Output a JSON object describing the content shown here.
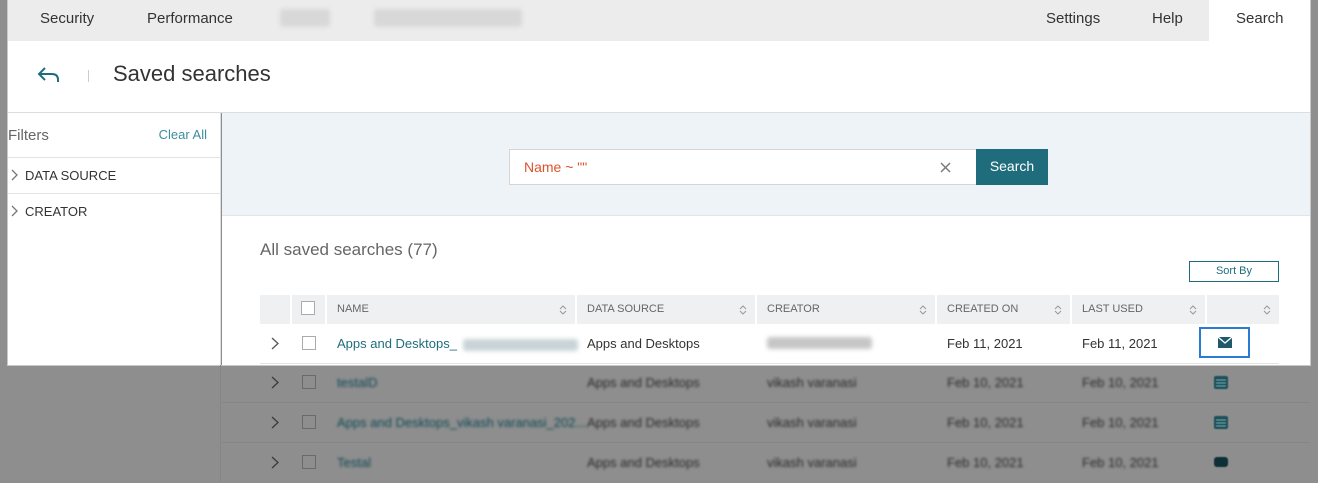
{
  "nav": {
    "tabs": [
      "Security",
      "Performance"
    ],
    "right_tabs": [
      "Settings",
      "Help"
    ],
    "active_tab": "Search"
  },
  "header": {
    "title": "Saved searches"
  },
  "filters": {
    "title": "Filters",
    "clear_all": "Clear All",
    "groups": [
      "DATA SOURCE",
      "CREATOR"
    ]
  },
  "search": {
    "value": "Name ~ \"\"",
    "button": "Search"
  },
  "list": {
    "title": "All saved searches (77)",
    "sort_label": "Sort By",
    "columns": [
      "NAME",
      "DATA SOURCE",
      "CREATOR",
      "CREATED ON",
      "LAST USED"
    ],
    "rows": [
      {
        "name": "Apps and Desktops_",
        "data_source": "Apps and Desktops",
        "creator": "",
        "created_on": "Feb 11, 2021",
        "last_used": "Feb 11, 2021",
        "action_icon": "email-icon"
      },
      {
        "name": "testalD",
        "data_source": "Apps and Desktops",
        "creator": "vikash varanasi",
        "created_on": "Feb 10, 2021",
        "last_used": "Feb 10, 2021",
        "action_icon": "report-icon"
      },
      {
        "name": "Apps and Desktops_vikash varanasi_202...",
        "data_source": "Apps and Desktops",
        "creator": "vikash varanasi",
        "created_on": "Feb 10, 2021",
        "last_used": "Feb 10, 2021",
        "action_icon": "report-icon"
      },
      {
        "name": "Testal",
        "data_source": "Apps and Desktops",
        "creator": "vikash varanasi",
        "created_on": "Feb 10, 2021",
        "last_used": "Feb 10, 2021",
        "action_icon": "monitor-icon"
      }
    ]
  },
  "colors": {
    "accent": "#1f6d7c",
    "search_value": "#e0522a",
    "highlight": "#2a7bd4",
    "overlay": "#8e8e8e"
  }
}
